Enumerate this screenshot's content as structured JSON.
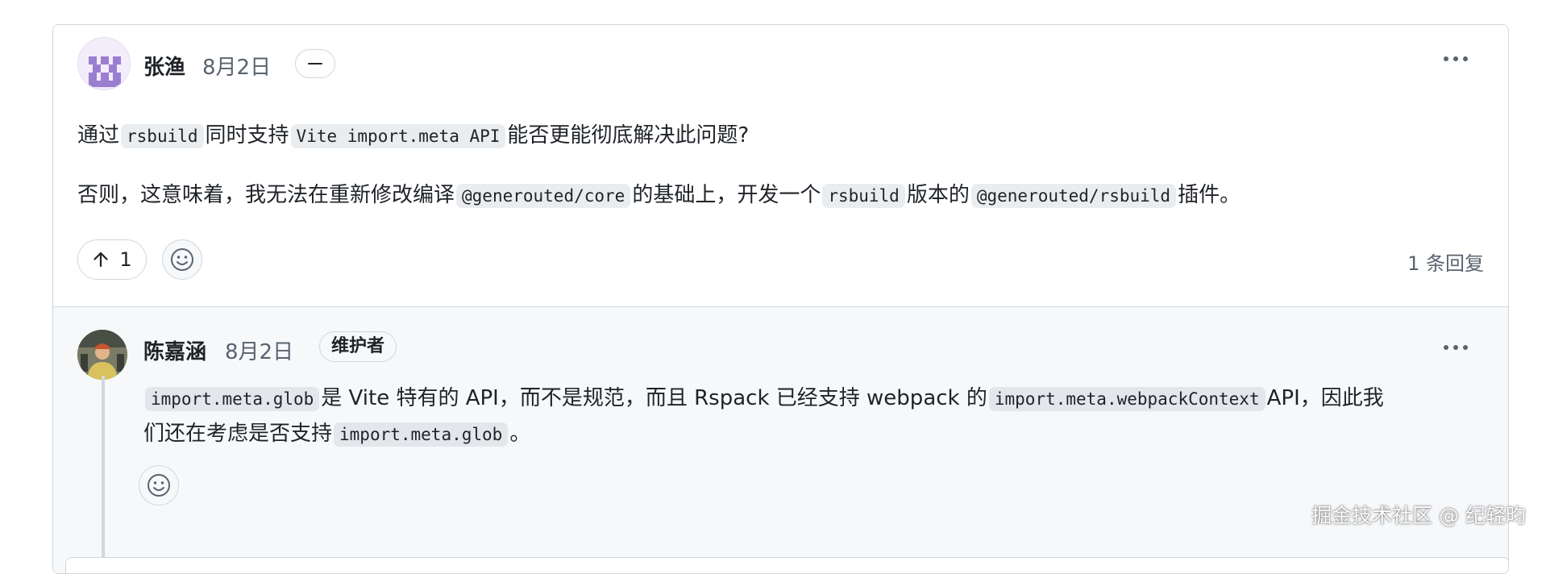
{
  "comment": {
    "author": "张渔",
    "date": "8月2日",
    "para1": {
      "t1": "通过",
      "c1": "rsbuild",
      "t2": "同时支持",
      "c2": "Vite import.meta API",
      "t3": "能否更能彻底解决此问题?"
    },
    "para2": {
      "t1": "否则，这意味着，我无法在重新修改编译",
      "c1": "@generouted/core",
      "t2": "的基础上，开发一个",
      "c2": "rsbuild",
      "t3": "版本的",
      "c3": "@generouted/rsbuild",
      "t4": "插件。"
    },
    "upvote_count": "1",
    "reply_count": "1 条回复"
  },
  "reply": {
    "author": "陈嘉涵",
    "date": "8月2日",
    "badge": "维护者",
    "line1": {
      "c1": "import.meta.glob",
      "t1": "是 Vite 特有的 API，而不是规范，而且 Rspack 已经支持 webpack 的",
      "c2": "import.meta.webpackContext",
      "t2": "API，因此我"
    },
    "line2": {
      "t1": "们还在考虑是否支持",
      "c1": "import.meta.glob",
      "t2": "。"
    }
  },
  "watermark": "掘金技术社区 @ 纪轻昀",
  "icons": [
    "minus-icon",
    "kebab-menu-icon",
    "arrow-up-icon",
    "smiley-icon"
  ],
  "colors": {
    "border": "#d0d7de",
    "reply_bg": "#f6f8fa",
    "code_bg": "#eaedf0",
    "muted_text": "#59636e"
  }
}
